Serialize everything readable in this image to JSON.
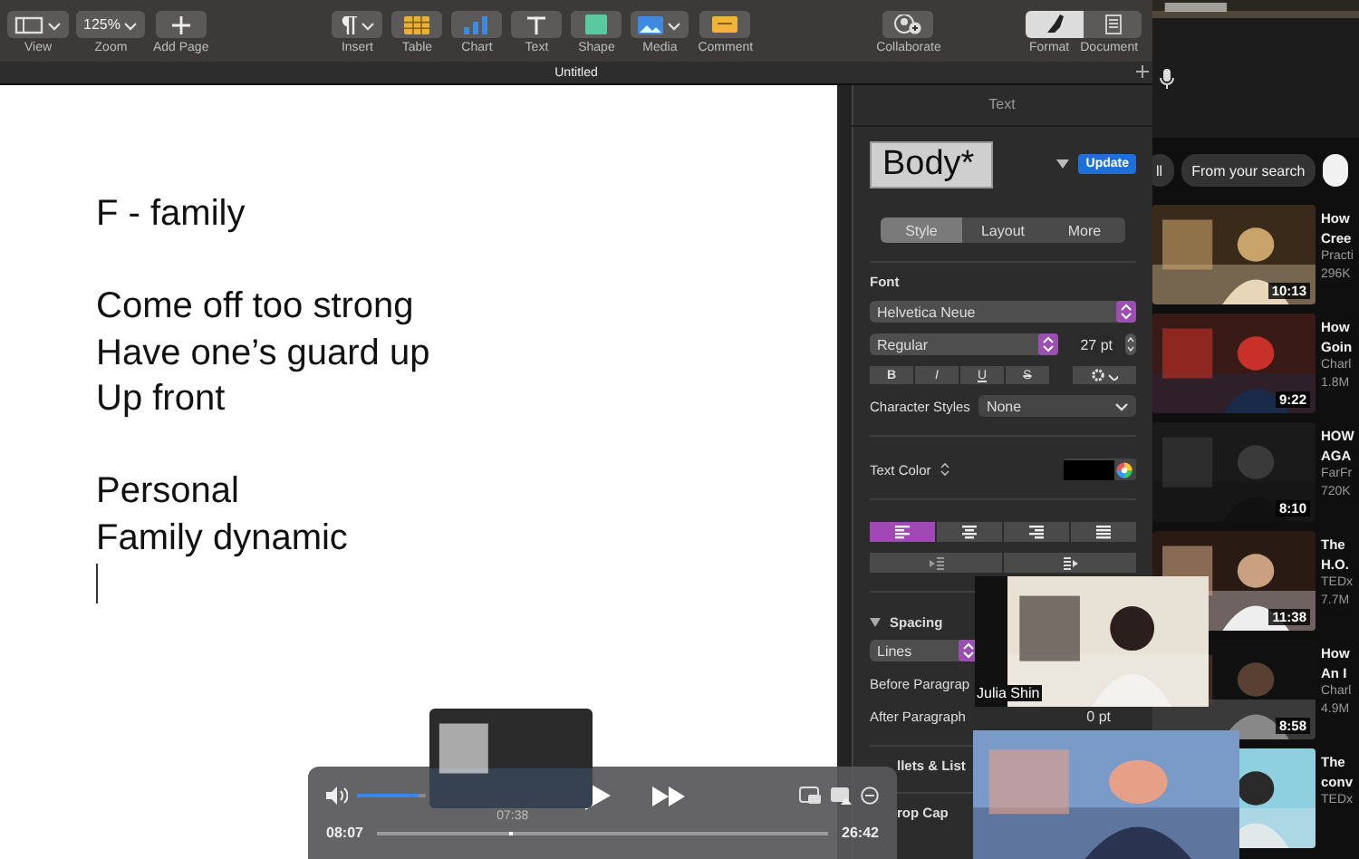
{
  "toolbar": {
    "left": [
      {
        "kind": "view",
        "label": "View"
      },
      {
        "kind": "zoom",
        "label": "Zoom",
        "value": "125%"
      },
      {
        "kind": "add",
        "label": "Add Page"
      }
    ],
    "center": [
      {
        "kind": "insert",
        "label": "Insert"
      },
      {
        "kind": "table",
        "label": "Table"
      },
      {
        "kind": "chart",
        "label": "Chart"
      },
      {
        "kind": "text",
        "label": "Text"
      },
      {
        "kind": "shape",
        "label": "Shape"
      },
      {
        "kind": "media",
        "label": "Media"
      },
      {
        "kind": "comment",
        "label": "Comment"
      }
    ],
    "right": [
      {
        "kind": "collaborate",
        "label": "Collaborate"
      }
    ],
    "panel_tabs": [
      {
        "kind": "format",
        "label": "Format",
        "selected": true
      },
      {
        "kind": "document",
        "label": "Document",
        "selected": false
      }
    ]
  },
  "tab_bar": {
    "title": "Untitled"
  },
  "document": {
    "blocks": [
      {
        "lines": [
          "F - family"
        ]
      },
      {
        "lines": [
          "Come off too strong",
          "Have one’s guard up",
          "Up front"
        ]
      },
      {
        "lines": [
          "Personal",
          "Family dynamic"
        ]
      }
    ]
  },
  "inspector": {
    "header": "Text",
    "style_name": "Body*",
    "update": "Update",
    "segments": [
      {
        "label": "Style",
        "selected": true
      },
      {
        "label": "Layout",
        "selected": false
      },
      {
        "label": "More",
        "selected": false
      }
    ],
    "font_label": "Font",
    "font": "Helvetica Neue",
    "typeface": "Regular",
    "size": "27 pt",
    "format_buttons": [
      {
        "label": "B",
        "kind": "bold"
      },
      {
        "label": "I",
        "kind": "italic"
      },
      {
        "label": "U",
        "kind": "underline"
      },
      {
        "label": "S",
        "kind": "strike"
      }
    ],
    "character_styles": {
      "label": "Character Styles",
      "value": "None"
    },
    "text_color": "Text Color",
    "alignment": [
      {
        "kind": "left",
        "selected": true
      },
      {
        "kind": "center",
        "selected": false
      },
      {
        "kind": "right",
        "selected": false
      },
      {
        "kind": "justify",
        "selected": false
      }
    ],
    "spacing": {
      "label": "Spacing",
      "expanded": true,
      "mode": "Lines",
      "before": "Before Paragrap",
      "after": "After Paragraph",
      "after_value": "0 pt"
    },
    "bullets": "llets & List",
    "drop_cap": "rop Cap"
  },
  "browser": {
    "chips": [
      {
        "label": "ll"
      },
      {
        "label": "From your search"
      }
    ],
    "videos": [
      {
        "duration": "10:13",
        "title": [
          "How",
          "Cree"
        ],
        "channel": "Practi",
        "views": "296K"
      },
      {
        "duration": "9:22",
        "title": [
          "How",
          "Goin"
        ],
        "channel": "Charl",
        "views": "1.8M"
      },
      {
        "duration": "8:10",
        "title": [
          "HOW",
          "AGA"
        ],
        "channel": "FarFr",
        "views": "720K"
      },
      {
        "duration": "11:38",
        "title": [
          "The",
          "H.O."
        ],
        "channel": "TEDx",
        "views": "7.7M"
      },
      {
        "duration": "8:58",
        "title": [
          "How",
          "An I"
        ],
        "channel": "Charl",
        "views": "4.9M"
      },
      {
        "title": [
          "The",
          "conv"
        ],
        "channel": "TEDx"
      }
    ]
  },
  "player": {
    "current": "08:07",
    "hover_time": "07:38",
    "total": "26:42",
    "volume": {
      "level": 0.9
    },
    "progress": {
      "level": 0.3
    }
  },
  "call": {
    "participants": [
      {
        "kind": "picture",
        "name": "Julia Shin"
      },
      {
        "kind": "picture"
      }
    ]
  }
}
